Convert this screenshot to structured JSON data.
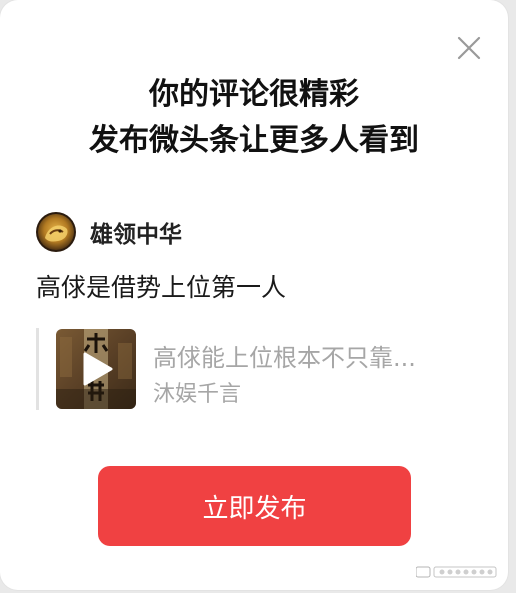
{
  "dialog": {
    "close_icon": "close-icon",
    "title_line1": "你的评论很精彩",
    "title_line2": "发布微头条让更多人看到"
  },
  "author": {
    "avatar_icon": "avatar",
    "name": "雄领中华"
  },
  "comment": {
    "text": "高俅是借势上位第一人"
  },
  "quoted_post": {
    "thumbnail_icon": "video-thumbnail",
    "play_icon": "play-icon",
    "title": "高俅能上位根本不只靠...",
    "source": "沐娱千言"
  },
  "actions": {
    "publish_label": "立即发布"
  },
  "colors": {
    "primary": "#f04142",
    "title_text": "#111111",
    "muted_text": "#a6a6a6",
    "background": "#ffffff"
  }
}
